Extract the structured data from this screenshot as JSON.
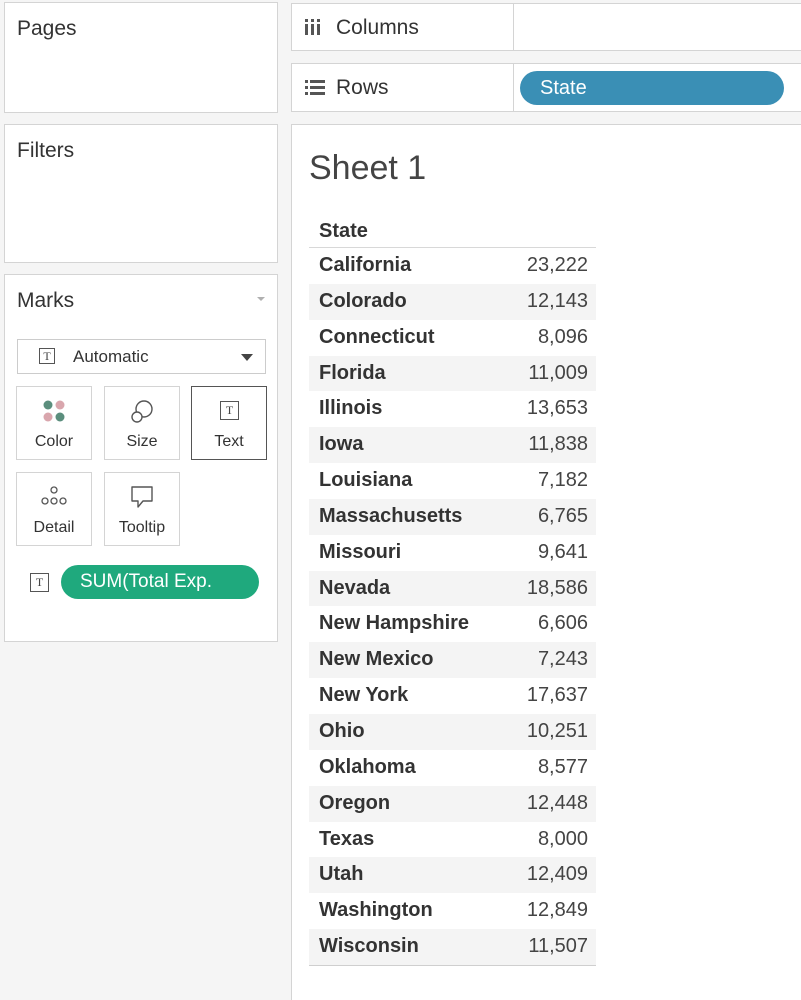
{
  "panels": {
    "pages_label": "Pages",
    "filters_label": "Filters",
    "marks": {
      "title": "Marks",
      "mark_type": "Automatic",
      "buttons": {
        "color": "Color",
        "size": "Size",
        "text": "Text",
        "detail": "Detail",
        "tooltip": "Tooltip"
      },
      "field_pill": "SUM(Total Exp.",
      "icon_glyph": "T"
    }
  },
  "shelves": {
    "columns_label": "Columns",
    "rows_label": "Rows",
    "rows_pill": "State"
  },
  "sheet": {
    "title": "Sheet 1",
    "column_header": "State",
    "rows": [
      {
        "state": "California",
        "value": "23,222"
      },
      {
        "state": "Colorado",
        "value": "12,143"
      },
      {
        "state": "Connecticut",
        "value": "8,096"
      },
      {
        "state": "Florida",
        "value": "11,009"
      },
      {
        "state": "Illinois",
        "value": "13,653"
      },
      {
        "state": "Iowa",
        "value": "11,838"
      },
      {
        "state": "Louisiana",
        "value": "7,182"
      },
      {
        "state": "Massachusetts",
        "value": "6,765"
      },
      {
        "state": "Missouri",
        "value": "9,641"
      },
      {
        "state": "Nevada",
        "value": "18,586"
      },
      {
        "state": "New Hampshire",
        "value": "6,606"
      },
      {
        "state": "New Mexico",
        "value": "7,243"
      },
      {
        "state": "New York",
        "value": "17,637"
      },
      {
        "state": "Ohio",
        "value": "10,251"
      },
      {
        "state": "Oklahoma",
        "value": "8,577"
      },
      {
        "state": "Oregon",
        "value": "12,448"
      },
      {
        "state": "Texas",
        "value": "8,000"
      },
      {
        "state": "Utah",
        "value": "12,409"
      },
      {
        "state": "Washington",
        "value": "12,849"
      },
      {
        "state": "Wisconsin",
        "value": "11,507"
      }
    ]
  },
  "colors": {
    "rows_pill": "#3a8fb5",
    "measure_pill": "#1fa97d"
  }
}
